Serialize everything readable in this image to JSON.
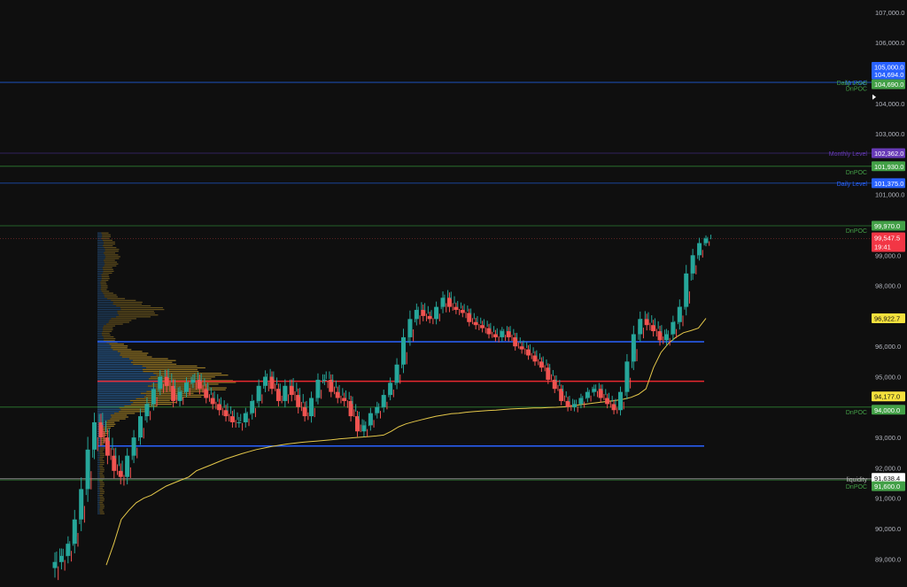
{
  "chart_data": {
    "type": "line",
    "title": "",
    "xlabel": "",
    "ylabel": "",
    "ylim": [
      88800,
      107400
    ],
    "y_ticks": [
      "107,000.0",
      "106,000.0",
      "105,000.0",
      "104,000.0",
      "103,000.0",
      "102,000.0",
      "101,000.0",
      "100,000.0",
      "99,000.0",
      "98,000.0",
      "97,000.0",
      "96,000.0",
      "95,000.0",
      "94,000.0",
      "93,000.0",
      "92,000.0",
      "91,000.0",
      "90,000.0",
      "89,000.0"
    ],
    "y_tick_values": [
      107000,
      106000,
      105000,
      104000,
      103000,
      102000,
      101000,
      100000,
      99000,
      98000,
      97000,
      96000,
      95000,
      94000,
      93000,
      92000,
      91000,
      90000,
      89000
    ],
    "grid": false,
    "legend": "none",
    "colors": {
      "background": "#0f0f0f",
      "bull_candle": "#26a69a",
      "bear_candle": "#ef5350",
      "vwap": "#e5c84a",
      "profile_blue": "#2f6fb3",
      "profile_gold": "#b8912b",
      "poc_red": "#e8282f",
      "value_area_blue": "#2962ff",
      "green_level": "#43a047",
      "blue_level": "#1e57c8",
      "purple_level": "#673ab7"
    },
    "levels": [
      {
        "name": "MnPOC",
        "value": 104694,
        "label": "104,694.0",
        "color": "#2962ff",
        "line": "#1e57c8"
      },
      {
        "name": "Daily Level",
        "value": 104690,
        "label": "104,690.0",
        "color": "#43a047",
        "line": "#1e57c8"
      },
      {
        "name": "DnPOC",
        "value": 104500,
        "label": "",
        "color": "#43a047",
        "line": ""
      },
      {
        "name": "Monthly Level",
        "value": 102362,
        "label": "102,362.0",
        "color": "#673ab7",
        "line": "#3e2a7a"
      },
      {
        "name": "DnPOC",
        "value": 101930,
        "label": "101,930.0",
        "color": "#43a047",
        "line": "#2e7d32"
      },
      {
        "name": "Daily Level",
        "value": 101375,
        "label": "101,375.0",
        "color": "#2962ff",
        "line": "#1e57c8"
      },
      {
        "name": "DnPOC",
        "value": 99970,
        "label": "99,970.0",
        "color": "#43a047",
        "line": "#2e7d32"
      },
      {
        "name": "DnPOC",
        "value": 94000,
        "label": "94,000.0",
        "color": "#43a047",
        "line": "#2e7d32"
      },
      {
        "name": "liquidity",
        "value": 91638.4,
        "label": "91,638.4",
        "color": "#ffffff",
        "line": "#9e9e9e"
      },
      {
        "name": "DnPOC",
        "value": 91600,
        "label": "91,600.0",
        "color": "#43a047",
        "line": "#2e7d32"
      }
    ],
    "price_tags": [
      {
        "value": 105000,
        "label": "105,000.0",
        "color": "#2962ff"
      },
      {
        "value": 99547.5,
        "label": "99,547.5",
        "sub": "19:41",
        "color": "#f23645"
      },
      {
        "value": 96922.7,
        "label": "96,922.7",
        "color": "#f5e13d"
      },
      {
        "value": 94177,
        "label": "94,177.0",
        "color": "#f5e13d"
      }
    ],
    "volume_profile": {
      "poc": 94850,
      "vah": 96150,
      "val": 92720
    },
    "series": [
      {
        "name": "",
        "kind": "candles",
        "close": [
          88900,
          89100,
          89500,
          90300,
          91300,
          92600,
          93500,
          93000,
          92400,
          91900,
          91700,
          92400,
          93000,
          93700,
          94100,
          94600,
          95000,
          94700,
          94200,
          94500,
          94800,
          94900,
          94600,
          94300,
          94100,
          93900,
          93700,
          93500,
          93500,
          93800,
          94200,
          94700,
          95000,
          94600,
          94200,
          94700,
          94400,
          94000,
          93700,
          94300,
          94900,
          94900,
          94500,
          94300,
          94200,
          93700,
          93200,
          93400,
          93800,
          94000,
          94400,
          94800,
          95400,
          96300,
          96900,
          97200,
          97000,
          96900,
          97300,
          97600,
          97300,
          97200,
          97100,
          96800,
          96700,
          96600,
          96400,
          96300,
          96500,
          96300,
          96000,
          95900,
          95700,
          95500,
          95300,
          94900,
          94600,
          94200,
          94000,
          94100,
          94300,
          94500,
          94600,
          94300,
          94100,
          93900,
          94500,
          95500,
          96400,
          96900,
          96700,
          96500,
          96200,
          96400,
          96800,
          97300,
          98400,
          99000,
          99400,
          99550
        ],
        "range": [
          900,
          700,
          700,
          900,
          1100,
          1200,
          900,
          800,
          800,
          700,
          700,
          700,
          700,
          700,
          600,
          600,
          600,
          600,
          600,
          500,
          500,
          500,
          500,
          500,
          500,
          500,
          500,
          500,
          500,
          500,
          600,
          600,
          600,
          500,
          500,
          600,
          600,
          600,
          500,
          600,
          600,
          500,
          500,
          500,
          500,
          500,
          500,
          500,
          500,
          500,
          500,
          500,
          600,
          800,
          800,
          600,
          500,
          400,
          500,
          600,
          500,
          400,
          400,
          400,
          400,
          400,
          400,
          400,
          400,
          400,
          400,
          400,
          400,
          400,
          400,
          400,
          400,
          400,
          400,
          400,
          400,
          400,
          400,
          400,
          400,
          400,
          500,
          700,
          800,
          700,
          500,
          500,
          500,
          500,
          600,
          700,
          800,
          600,
          500,
          300
        ]
      },
      {
        "name": "",
        "kind": "vwap",
        "values": [
          88800,
          89500,
          90300,
          90600,
          90850,
          91000,
          91100,
          91250,
          91400,
          91500,
          91600,
          91700,
          91900,
          92000,
          92100,
          92200,
          92300,
          92380,
          92460,
          92530,
          92600,
          92650,
          92700,
          92740,
          92780,
          92810,
          92840,
          92860,
          92880,
          92900,
          92920,
          92950,
          92970,
          92990,
          93010,
          93030,
          93050,
          93080,
          93200,
          93350,
          93450,
          93520,
          93580,
          93640,
          93700,
          93740,
          93780,
          93800,
          93830,
          93850,
          93870,
          93890,
          93900,
          93920,
          93940,
          93950,
          93960,
          93970,
          93975,
          93985,
          93995,
          94010,
          94030,
          94070,
          94100,
          94130,
          94160,
          94190,
          94220,
          94260,
          94320,
          94420,
          94600,
          95300,
          95800,
          96100,
          96300,
          96450,
          96520,
          96600,
          96922.7
        ]
      }
    ]
  }
}
